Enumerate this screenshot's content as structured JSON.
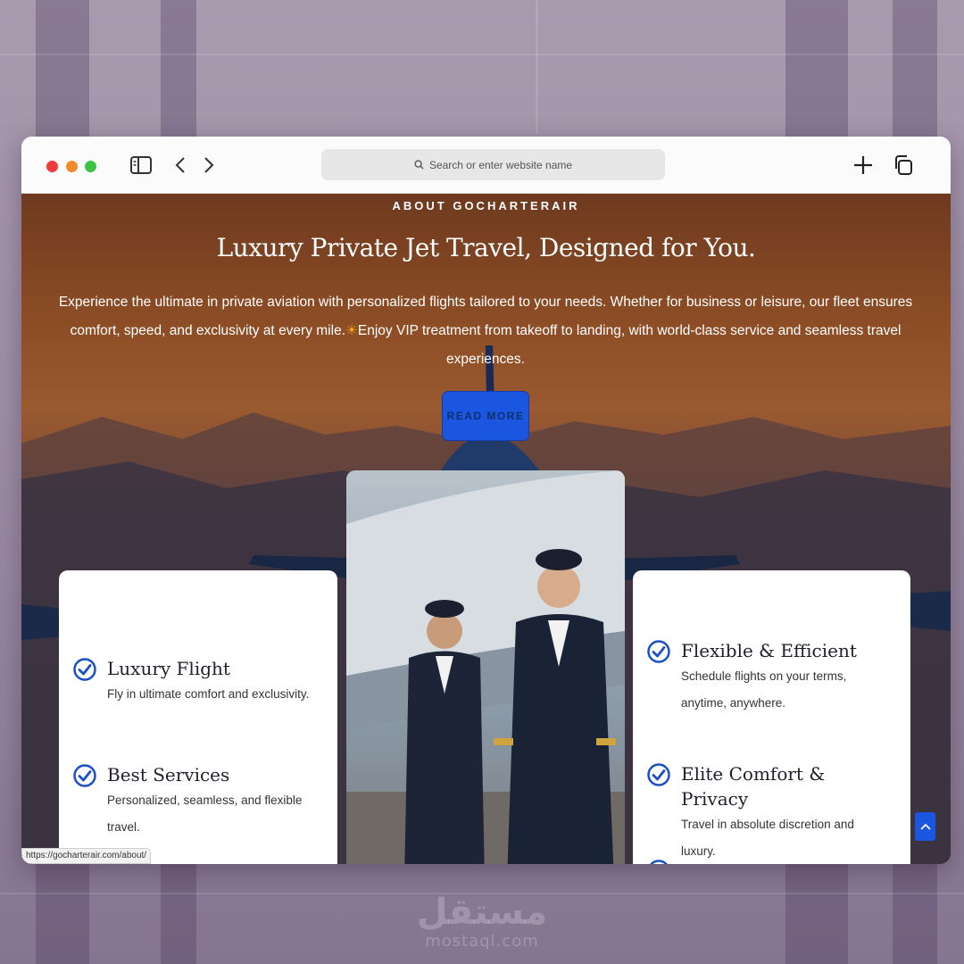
{
  "browser": {
    "search_placeholder": "Search or enter website name",
    "status_url": "https://gocharterair.com/about/"
  },
  "hero": {
    "eyebrow": "ABOUT GOCHARTERAIR",
    "headline": "Luxury Private Jet Travel, Designed for You.",
    "lead_line1": "Experience the ultimate in private aviation with personalized flights tailored to your needs. Whether for business or leisure, our fleet ensures comfort, speed, and exclusivity at",
    "lead_line2_a": "every mile.",
    "lead_line2_b": "Enjoy VIP treatment from takeoff to landing, with world-class service and seamless travel experiences.",
    "button_label": "READ MORE"
  },
  "features_left": [
    {
      "title": "Luxury Flight",
      "text": "Fly in ultimate comfort and exclusivity."
    },
    {
      "title": "Best Services",
      "text": "Personalized, seamless, and flexible travel."
    }
  ],
  "features_right": [
    {
      "title": "Flexible & Efficient",
      "text": "Schedule flights on your terms, anytime, anywhere."
    },
    {
      "title": "Elite Comfort & Privacy",
      "text": "Travel in absolute discretion and luxury."
    }
  ],
  "watermark": {
    "arabic": "مستقل",
    "latin": "mostaql.com"
  },
  "colors": {
    "accent": "#1a56e0",
    "check": "#1a4fc9"
  }
}
